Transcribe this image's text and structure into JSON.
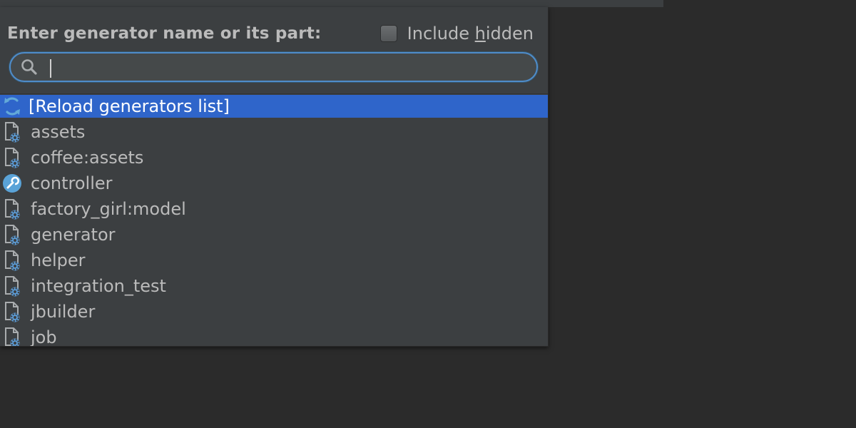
{
  "dialog": {
    "prompt_label": "Enter generator name or its part:",
    "include_hidden": {
      "label_prefix": "Include ",
      "label_mnemonic": "h",
      "label_suffix": "idden",
      "checked": false
    },
    "search": {
      "value": "",
      "placeholder": ""
    }
  },
  "list": {
    "items": [
      {
        "label": "[Reload generators list]",
        "icon": "reload-icon",
        "selected": true
      },
      {
        "label": "assets",
        "icon": "generator-file-icon",
        "selected": false
      },
      {
        "label": "coffee:assets",
        "icon": "generator-file-icon",
        "selected": false
      },
      {
        "label": "controller",
        "icon": "wrench-icon",
        "selected": false
      },
      {
        "label": "factory_girl:model",
        "icon": "generator-file-icon",
        "selected": false
      },
      {
        "label": "generator",
        "icon": "generator-file-icon",
        "selected": false
      },
      {
        "label": "helper",
        "icon": "generator-file-icon",
        "selected": false
      },
      {
        "label": "integration_test",
        "icon": "generator-file-icon",
        "selected": false
      },
      {
        "label": "jbuilder",
        "icon": "generator-file-icon",
        "selected": false
      },
      {
        "label": "job",
        "icon": "generator-file-icon",
        "selected": false
      }
    ]
  },
  "colors": {
    "selection": "#2f65ca",
    "focus_ring": "#4f8cc9",
    "background": "#3c3f41",
    "text": "#bbbbbb"
  }
}
